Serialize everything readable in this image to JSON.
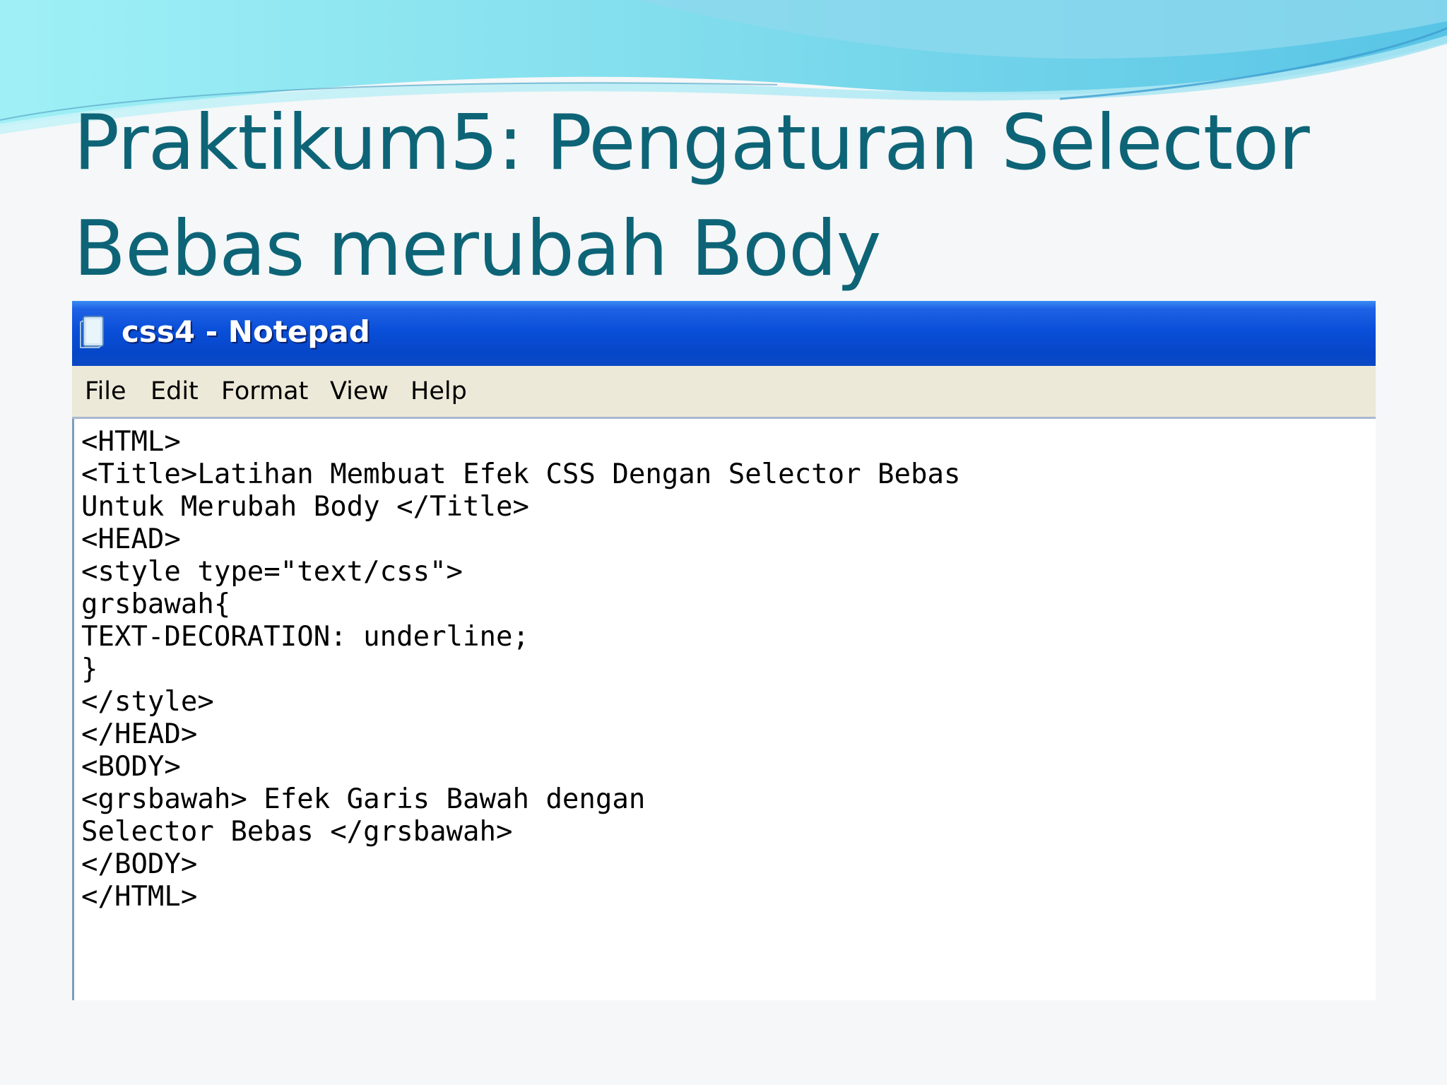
{
  "slide": {
    "title_line1": "Praktikum5: Pengaturan Selector",
    "title_line2": "Bebas merubah Body",
    "theme_colors": {
      "title": "#0e6477",
      "wave_light": "#8fe3f1",
      "wave_mid": "#5ccbe4",
      "wave_dark": "#2a9cc9"
    }
  },
  "window": {
    "title": "css4 - Notepad",
    "icon": "notepad-icon",
    "titlebar_color": "#0a4fd9",
    "menu": [
      "File",
      "Edit",
      "Format",
      "View",
      "Help"
    ]
  },
  "editor": {
    "lines": [
      "<HTML>",
      "<Title>Latihan Membuat Efek CSS Dengan Selector Bebas",
      "Untuk Merubah Body </Title>",
      "<HEAD>",
      "<style type=\"text/css\">",
      "grsbawah{",
      "TEXT-DECORATION: underline;",
      "}",
      "</style>",
      "</HEAD>",
      "<BODY>",
      "<grsbawah> Efek Garis Bawah dengan",
      "Selector Bebas </grsbawah>",
      "</BODY>",
      "</HTML>"
    ]
  }
}
